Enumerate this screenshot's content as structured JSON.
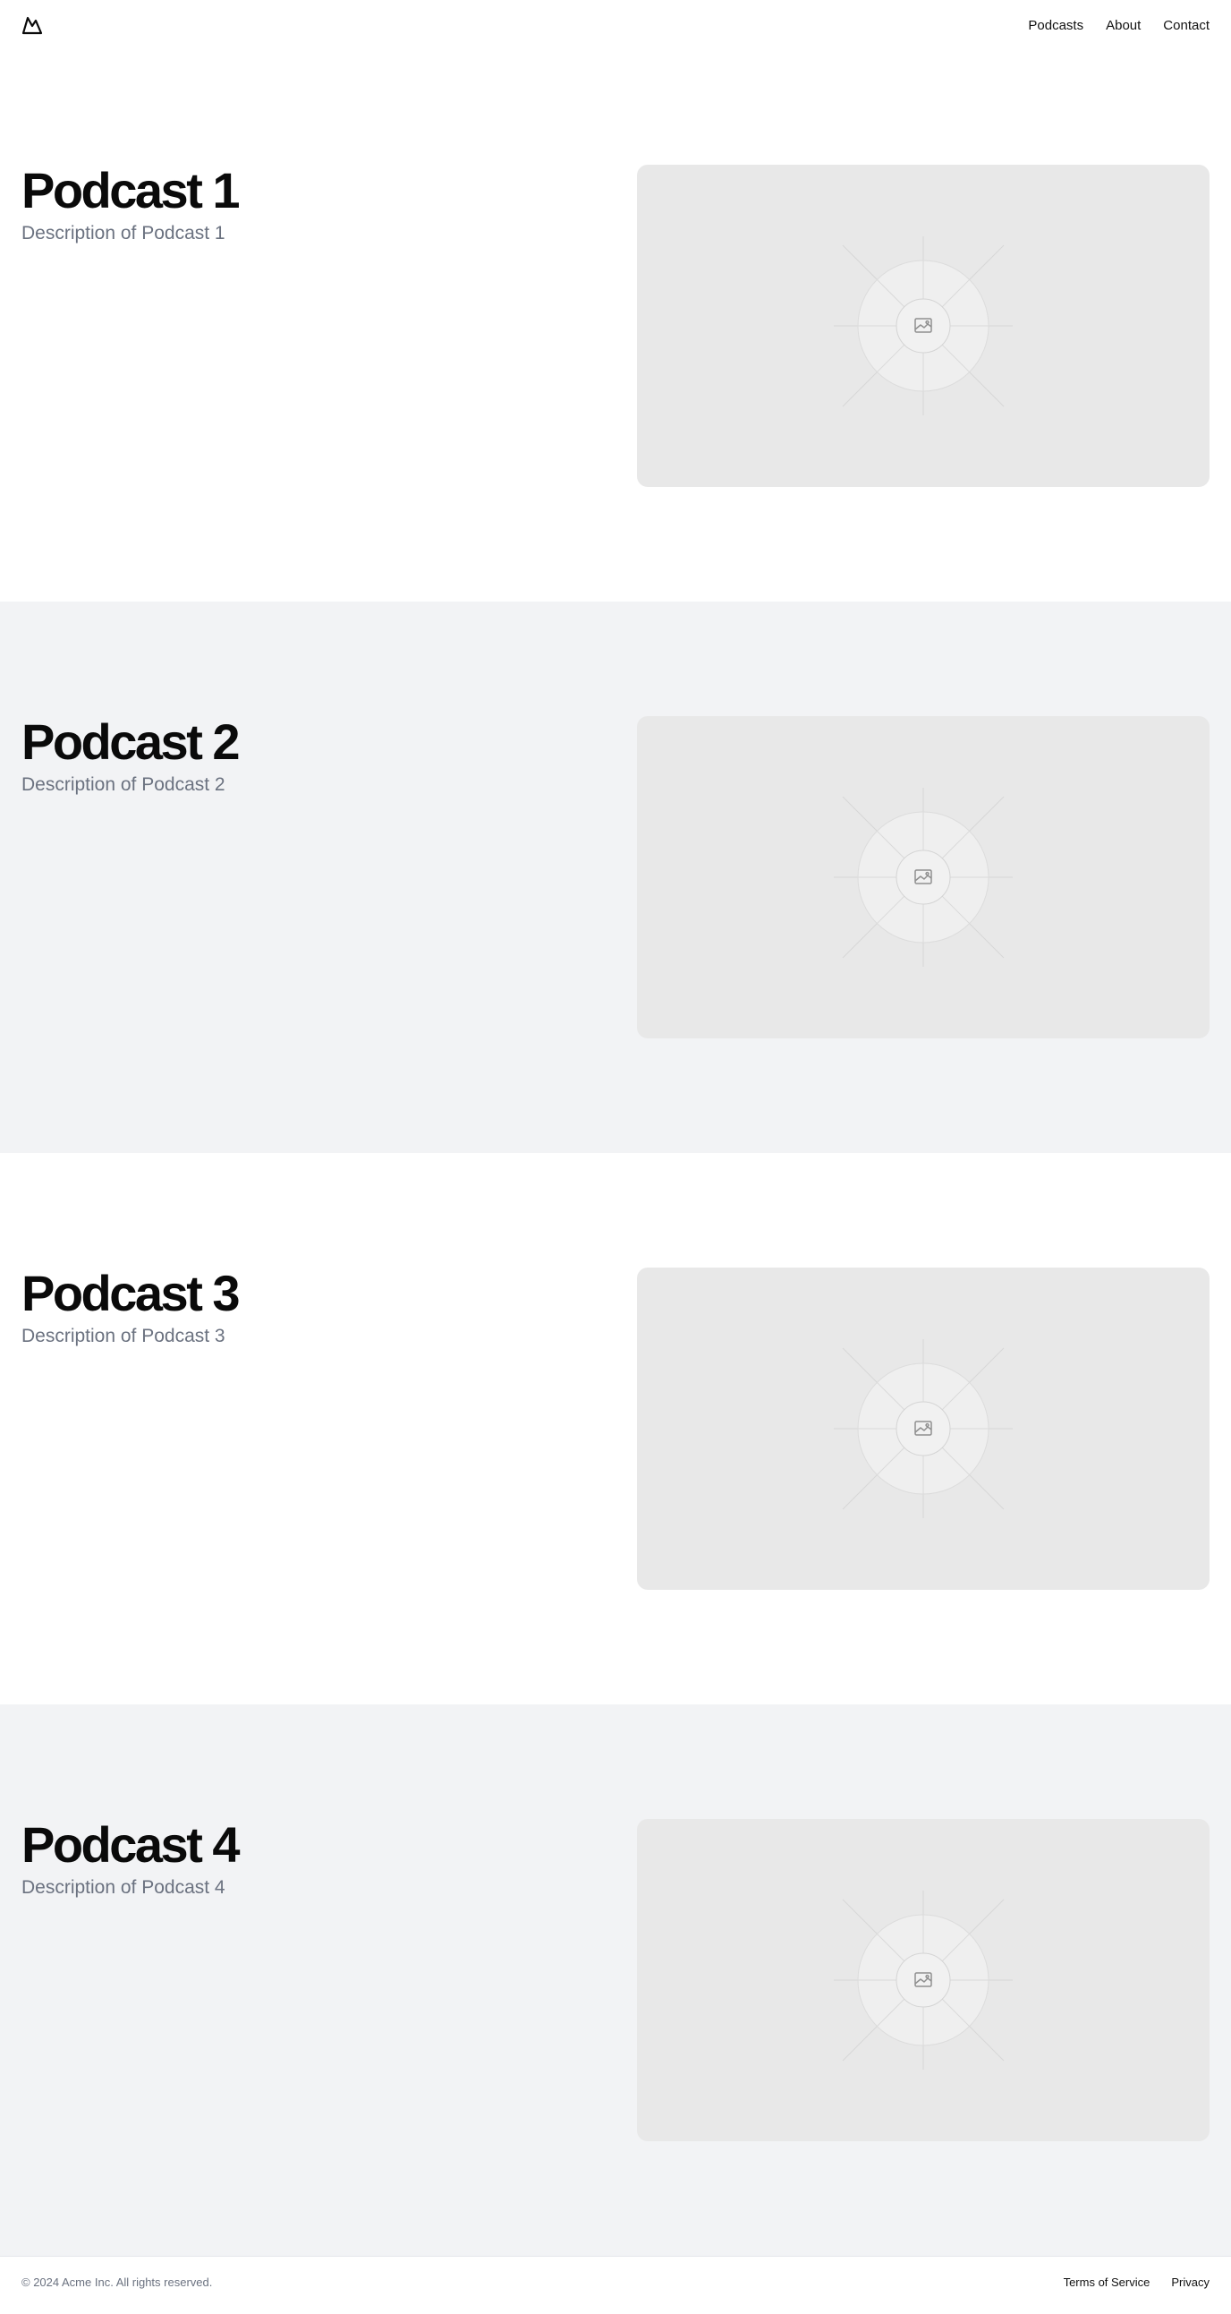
{
  "header": {
    "logo_icon": "mountain-icon",
    "nav": [
      {
        "label": "Podcasts"
      },
      {
        "label": "About"
      },
      {
        "label": "Contact"
      }
    ]
  },
  "podcasts": [
    {
      "title": "Podcast 1",
      "description": "Description of Podcast 1",
      "image_icon": "image-placeholder-icon"
    },
    {
      "title": "Podcast 2",
      "description": "Description of Podcast 2",
      "image_icon": "image-placeholder-icon"
    },
    {
      "title": "Podcast 3",
      "description": "Description of Podcast 3",
      "image_icon": "image-placeholder-icon"
    },
    {
      "title": "Podcast 4",
      "description": "Description of Podcast 4",
      "image_icon": "image-placeholder-icon"
    }
  ],
  "footer": {
    "copyright": "© 2024 Acme Inc. All rights reserved.",
    "links": [
      {
        "label": "Terms of Service"
      },
      {
        "label": "Privacy"
      }
    ]
  },
  "colors": {
    "background": "#ffffff",
    "alt_background": "#f2f3f5",
    "placeholder": "#e8e8e8",
    "muted_text": "#6b7280"
  }
}
